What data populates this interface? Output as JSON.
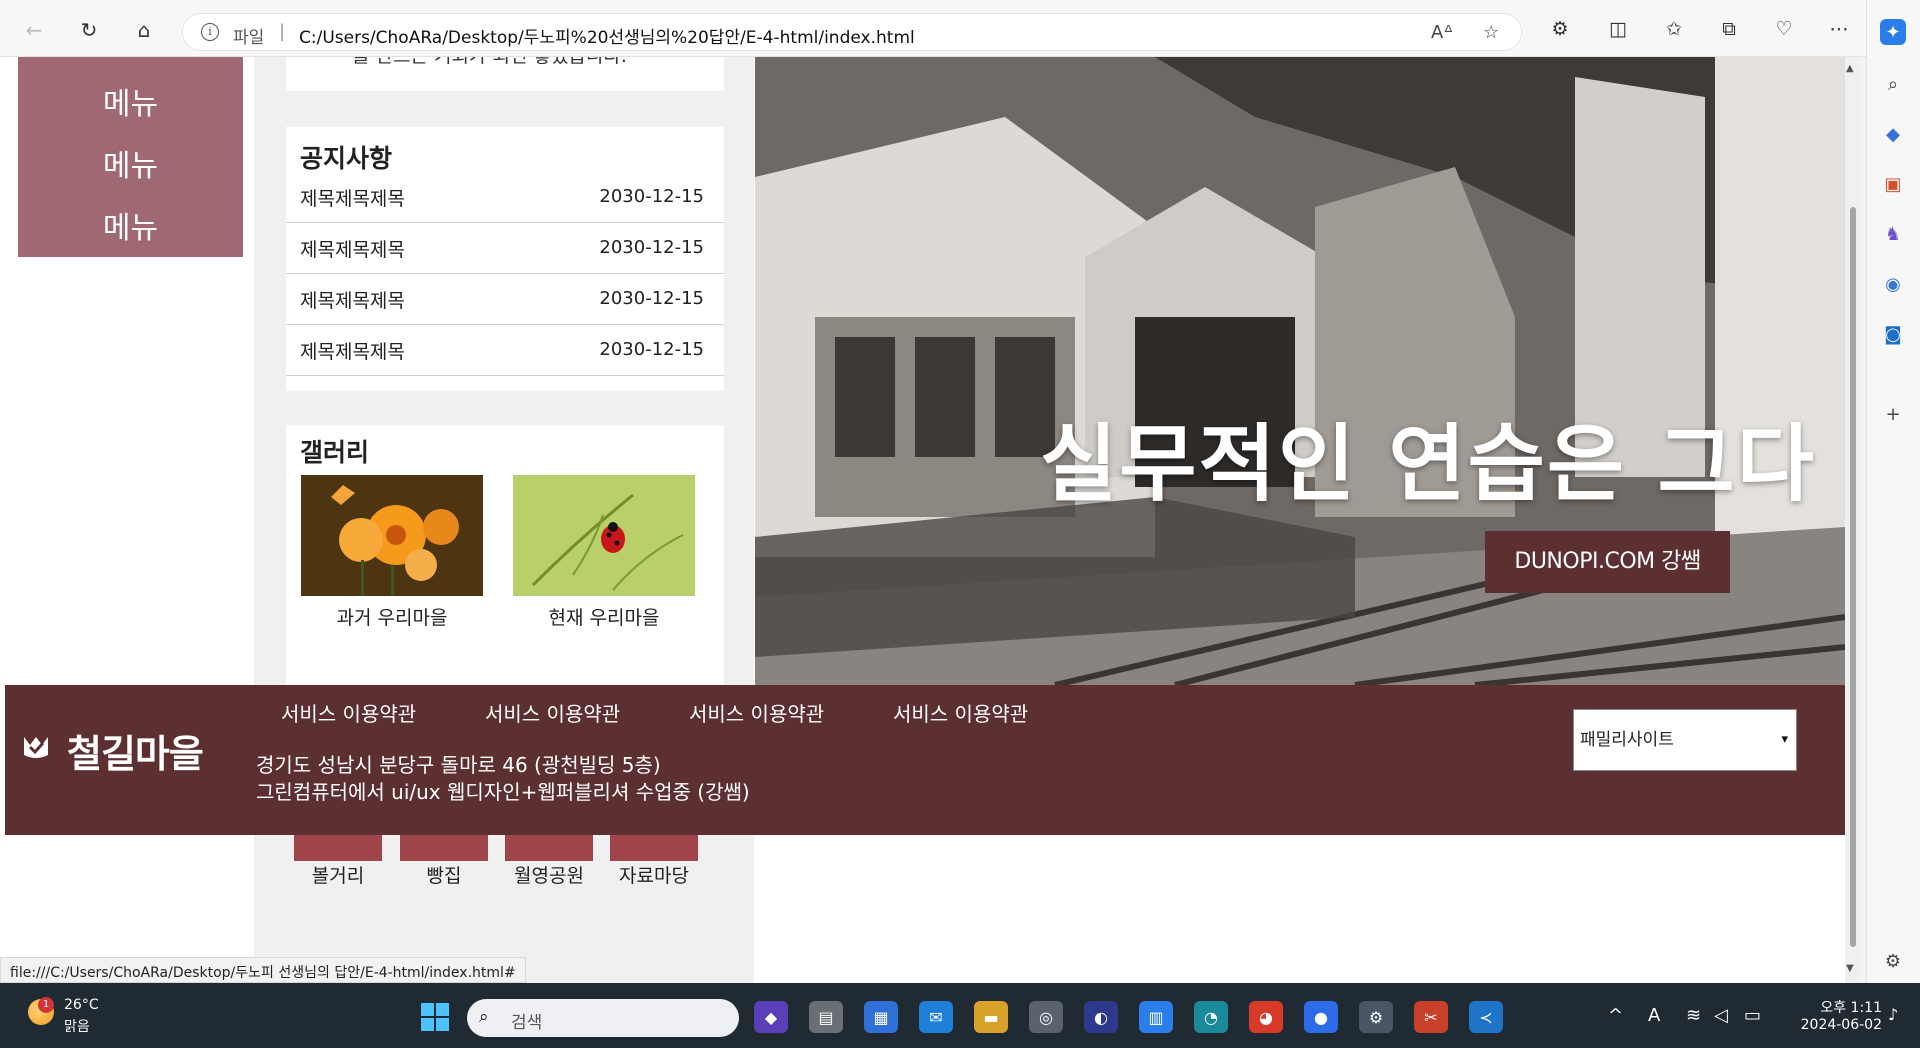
{
  "browser": {
    "scheme_label": "파일",
    "url": "C:/Users/ChoARa/Desktop/두노피%20선생님의%20답안/E-4-html/index.html",
    "status_url": "file:///C:/Users/ChoARa/Desktop/두노피 선생님의 답안/E-4-html/index.html#"
  },
  "page": {
    "top_fragment": "를 만드는 기회가 되면 좋겠습니다.",
    "menu": [
      "메뉴",
      "메뉴",
      "메뉴"
    ],
    "notice": {
      "title": "공지사항",
      "rows": [
        {
          "title": "제목제목제목",
          "date": "2030-12-15"
        },
        {
          "title": "제목제목제목",
          "date": "2030-12-15"
        },
        {
          "title": "제목제목제목",
          "date": "2030-12-15"
        },
        {
          "title": "제목제목제목",
          "date": "2030-12-15"
        }
      ]
    },
    "gallery": {
      "title": "갤러리",
      "items": [
        {
          "caption": "과거 우리마을"
        },
        {
          "caption": "현재 우리마을"
        }
      ]
    },
    "hero": {
      "headline": "실무적인 연습은 그다",
      "button": "DUNOPI.COM 강쌤"
    },
    "quick_links": [
      "볼거리",
      "빵집",
      "월영공원",
      "자료마당"
    ],
    "footer": {
      "logo": "철길마을",
      "links": [
        "서비스 이용약관",
        "서비스 이용약관",
        "서비스 이용약관",
        "서비스 이용약관"
      ],
      "address": "경기도 성남시 분당구 돌마로 46 (광천빌딩 5층)",
      "note": "그린컴퓨터에서 ui/ux 웹디자인+웹퍼블리셔 수업중 (강쌤)",
      "family_select": "패밀리사이트"
    }
  },
  "taskbar": {
    "weather_badge": "1",
    "temperature": "26°C",
    "condition": "맑음",
    "search_placeholder": "검색",
    "time": "오후 1:11",
    "date": "2024-06-02"
  },
  "colors": {
    "menu_bg": "#a06870",
    "footer_bg": "#5c2f30",
    "quick_bg": "#a0464a",
    "taskbar_bg": "#1f2a33"
  }
}
